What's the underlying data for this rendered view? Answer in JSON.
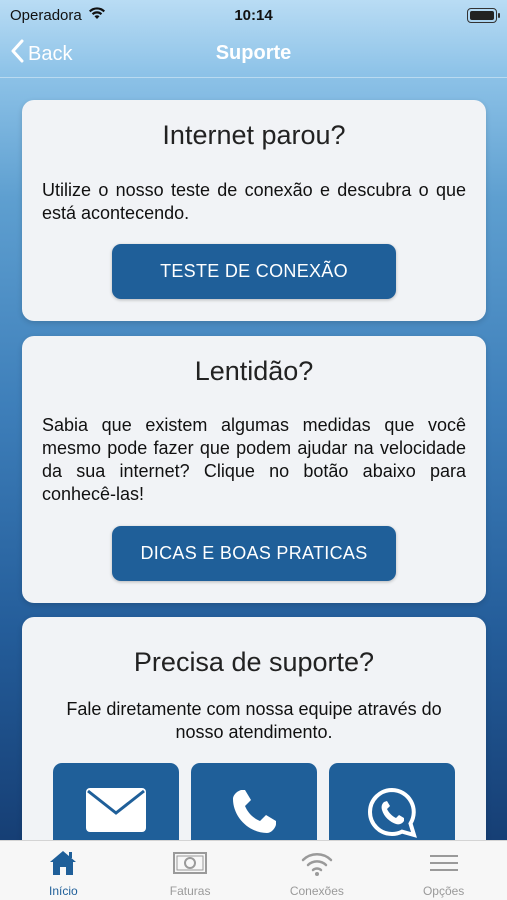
{
  "status_bar": {
    "carrier": "Operadora",
    "time": "10:14"
  },
  "nav": {
    "back_label": "Back",
    "title": "Suporte"
  },
  "cards": {
    "internet": {
      "title": "Internet parou?",
      "text": "Utilize o nosso teste de conexão e descubra o que está acontecendo.",
      "button": "TESTE DE CONEXÃO"
    },
    "slowness": {
      "title": "Lentidão?",
      "text": "Sabia que existem algumas medidas que você mesmo pode fazer que podem ajudar na velocidade da sua internet? Clique no botão abaixo para conhecê-las!",
      "button": "DICAS E BOAS PRATICAS"
    },
    "support": {
      "title": "Precisa de suporte?",
      "text": "Fale diretamente com nossa equipe através do nosso atendimento.",
      "contacts": [
        {
          "icon": "envelope-icon"
        },
        {
          "icon": "phone-icon"
        },
        {
          "icon": "whatsapp-icon"
        }
      ]
    }
  },
  "tab_bar": {
    "tabs": [
      {
        "label": "Início",
        "icon": "home-icon",
        "active": true
      },
      {
        "label": "Faturas",
        "icon": "banknote-icon",
        "active": false
      },
      {
        "label": "Conexões",
        "icon": "wifi-icon",
        "active": false
      },
      {
        "label": "Opções",
        "icon": "menu-icon",
        "active": false
      }
    ]
  },
  "colors": {
    "primary": "#1f5f99",
    "tab_inactive": "#9a9a9a",
    "card_bg": "#f1f3f6"
  }
}
